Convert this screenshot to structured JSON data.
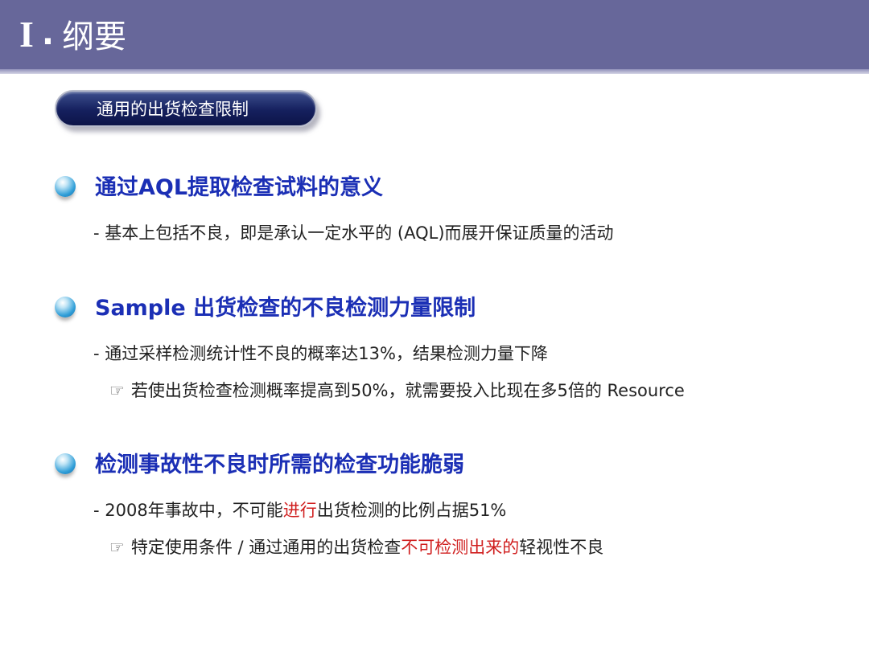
{
  "header": {
    "numeral": "I",
    "dot": ".",
    "title": "纲要"
  },
  "badge": {
    "label": "通用的出货检查限制"
  },
  "sections": [
    {
      "heading": "通过AQL提取检查试料的意义",
      "lines": [
        {
          "text": "- 基本上包括不良，即是承认一定水平的 (AQL)而展开保证质量的活动"
        }
      ]
    },
    {
      "heading": "Sample 出货检查的不良检测力量限制",
      "lines": [
        {
          "text": "- 通过采样检测统计性不良的概率达13%，结果检测力量下降"
        },
        {
          "icon": "☞",
          "text": "若使出货检查检测概率提高到50%，就需要投入比现在多5倍的 Resource"
        }
      ]
    },
    {
      "heading": "检测事故性不良时所需的检查功能脆弱",
      "lines": [
        {
          "pre": "- 2008年事故中，不可能",
          "red": "进行",
          "post": "出货检测的比例占据51%"
        },
        {
          "icon": "☞",
          "pre": "特定使用条件 / 通过通用的出货检查",
          "red": "不可检测出来的",
          "post": "轻视性不良"
        }
      ]
    }
  ],
  "colors": {
    "header_bg": "#67679a",
    "heading": "#1b2fb5",
    "badge": "#15205e",
    "highlight": "#d01f1f",
    "body_text": "#222222"
  },
  "icons": {
    "bullet": "blue-sphere-icon",
    "pointer": "pointing-hand-icon"
  }
}
